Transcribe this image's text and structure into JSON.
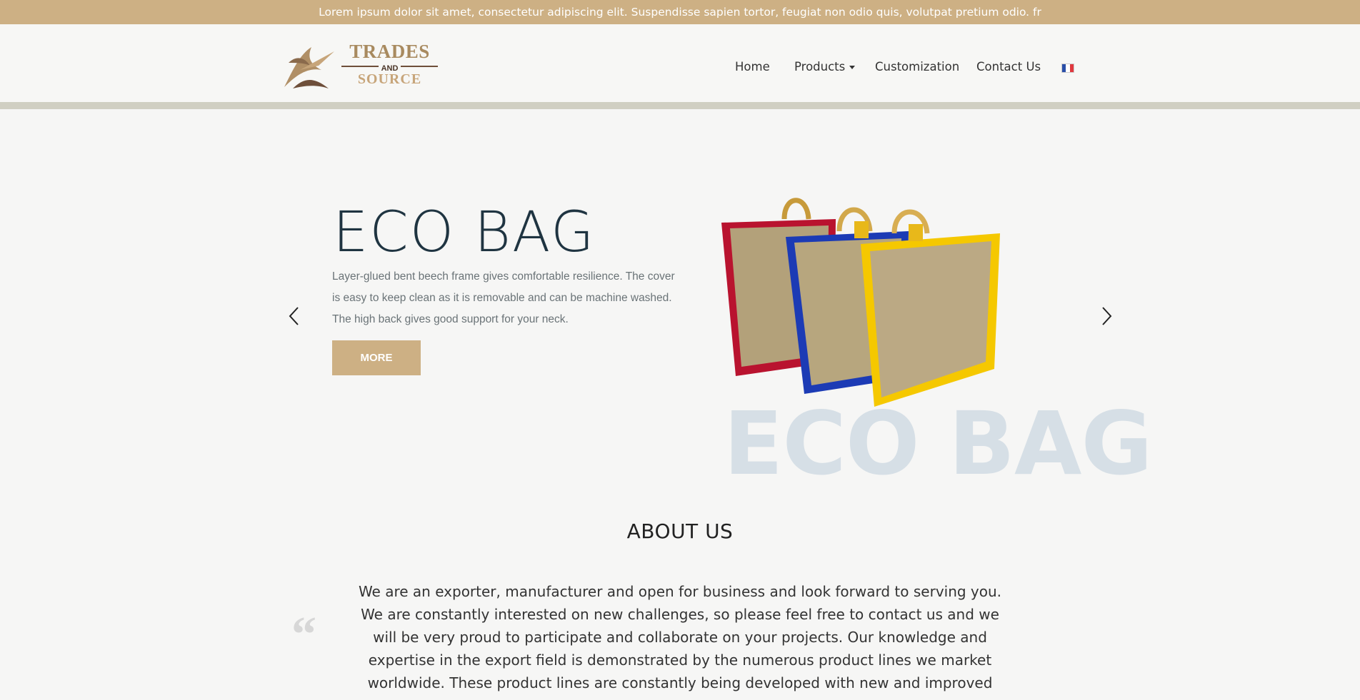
{
  "announcement": "Lorem ipsum dolor sit amet, consectetur adipiscing elit. Suspendisse sapien tortor, feugiat non odio quis, volutpat pretium odio. fr",
  "logo": {
    "line1": "TRADES",
    "line2": "AND",
    "line3": "SOURCE"
  },
  "nav": {
    "home": "Home",
    "products": "Products",
    "customization": "Customization",
    "contact": "Contact Us",
    "language_flag": "french-flag-icon"
  },
  "hero": {
    "title": "ECO BAG",
    "description": "Layer-glued bent beech frame gives comfortable resilience. The cover is easy to keep clean as it is removable and can be machine washed. The high back gives good support for your neck.",
    "button": "MORE",
    "ghost_text": "ECO BAG",
    "image": "jute-bags-image",
    "prev_icon": "chevron-left-icon",
    "next_icon": "chevron-right-icon"
  },
  "about": {
    "title": "ABOUT US",
    "text": "We are an exporter, manufacturer and open for business and look forward to serving you. We are constantly interested on new challenges, so please feel free to contact us and we will be very proud to participate and collaborate on your projects. Our knowledge and expertise in the export field is demonstrated by the numerous product lines we market worldwide. These product lines are constantly being developed with new and improved",
    "quote_mark": "“"
  },
  "colors": {
    "accent": "#cdb084",
    "title": "#1f3441",
    "ghost": "#d6dfe6",
    "rule": "#d0cfc2"
  }
}
